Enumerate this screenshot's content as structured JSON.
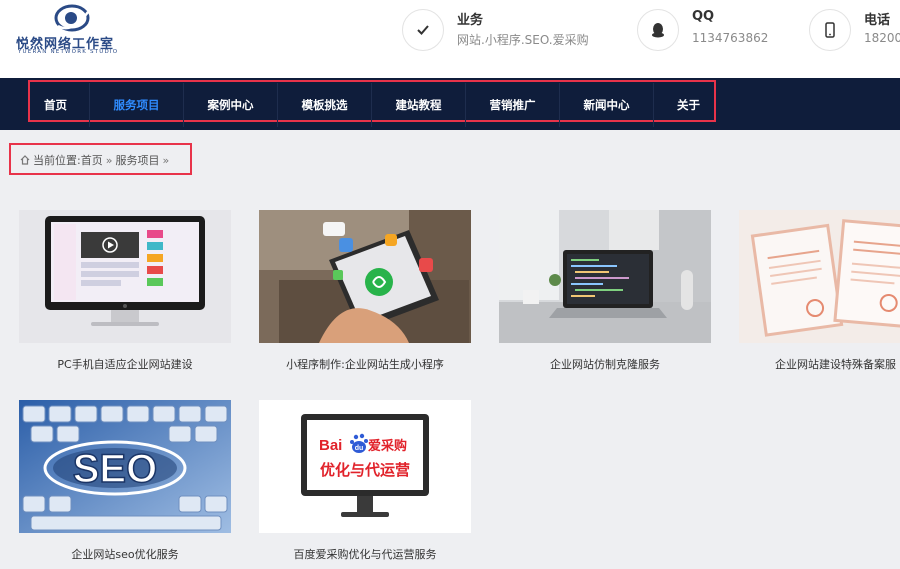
{
  "logo": {
    "title": "悦然网络工作室",
    "subtitle": "YUERAN NETWORK STUDIO"
  },
  "contacts": [
    {
      "title": "业务",
      "value": "网站.小程序.SEO.爱采购",
      "icon": "check-icon"
    },
    {
      "title": "QQ",
      "value": "1134763862",
      "icon": "qq-penguin-icon"
    },
    {
      "title": "电话",
      "value": "18200",
      "icon": "phone-icon"
    }
  ],
  "nav": {
    "items": [
      "首页",
      "服务项目",
      "案例中心",
      "模板挑选",
      "建站教程",
      "营销推广",
      "新闻中心",
      "关于"
    ],
    "active": "服务项目",
    "active_color": "#2f8cff",
    "bg_color": "#0f1d3b"
  },
  "breadcrumb": {
    "prefix": "当前位置:",
    "home": "首页",
    "current": "服务项目",
    "sep": "»"
  },
  "cards": [
    {
      "caption": "PC手机自适应企业网站建设",
      "image": "responsive-devices-illustration"
    },
    {
      "caption": "小程序制作:企业网站生成小程序",
      "image": "phone-mini-program-photo"
    },
    {
      "caption": "企业网站仿制克隆服务",
      "image": "laptop-code-desk-photo"
    },
    {
      "caption": "企业网站建设特殊备案服",
      "image": "filing-documents-photo"
    },
    {
      "caption": "企业网站seo优化服务",
      "image": "seo-keyboard-photo"
    },
    {
      "caption": "百度爱采购优化与代运营服务",
      "image": "baidu-aicaigou-monitor-illustration"
    }
  ],
  "thumb_text": {
    "baidu_logo": "Bai",
    "baidu_du": "du",
    "aicaigou": "爱采购",
    "service_line": "优化与代运营",
    "seo": "SEO"
  },
  "colors": {
    "highlight_frame": "#e8334a",
    "page_bg": "#eeeff2"
  }
}
